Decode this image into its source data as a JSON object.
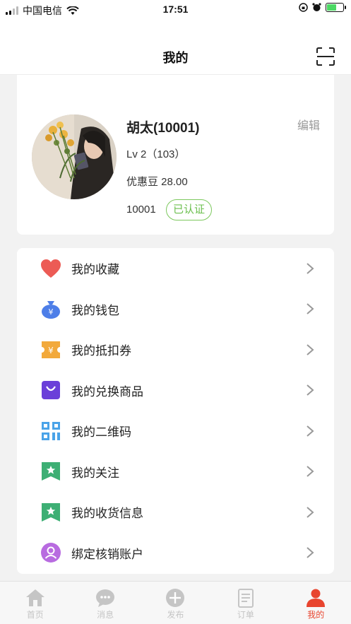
{
  "status_bar": {
    "carrier": "中国电信",
    "time": "17:51"
  },
  "header": {
    "title": "我的"
  },
  "profile": {
    "name": "胡太(10001)",
    "edit_label": "编辑",
    "level": "Lv 2（103）",
    "beans": "优惠豆 28.00",
    "uid": "10001",
    "verified_label": "已认证"
  },
  "menu": {
    "items": [
      {
        "label": "我的收藏",
        "icon": "heart-icon",
        "color": "#ec5b55"
      },
      {
        "label": "我的钱包",
        "icon": "money-bag-icon",
        "color": "#4d7ee8"
      },
      {
        "label": "我的抵扣券",
        "icon": "coupon-icon",
        "color": "#f2a93b"
      },
      {
        "label": "我的兑换商品",
        "icon": "shopping-bag-icon",
        "color": "#6b3fd9"
      },
      {
        "label": "我的二维码",
        "icon": "qr-code-icon",
        "color": "#4aa3e8"
      },
      {
        "label": "我的关注",
        "icon": "star-bookmark-icon",
        "color": "#3daf74"
      },
      {
        "label": "我的收货信息",
        "icon": "star-bookmark-icon",
        "color": "#3daf74"
      },
      {
        "label": "绑定核销账户",
        "icon": "user-circle-icon",
        "color": "#b86be0"
      }
    ]
  },
  "tab_bar": {
    "tabs": [
      {
        "label": "首页",
        "icon": "home-icon"
      },
      {
        "label": "消息",
        "icon": "message-icon"
      },
      {
        "label": "发布",
        "icon": "plus-circle-icon"
      },
      {
        "label": "订单",
        "icon": "order-icon"
      },
      {
        "label": "我的",
        "icon": "person-icon",
        "active": true
      }
    ],
    "active_color": "#e8452f",
    "inactive_color": "#c5c5c5"
  }
}
